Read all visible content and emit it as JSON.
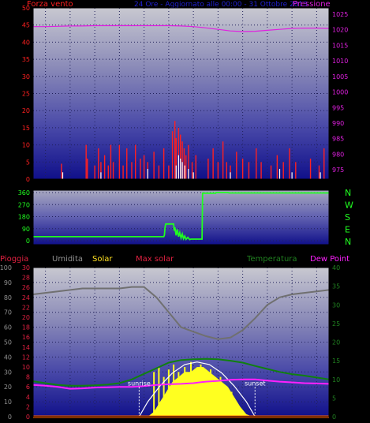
{
  "charts": {
    "top_title": "24 Ore - Aggiornato alle 00:00 - 31 Ottobre 2013",
    "wind_label": "Forza vento",
    "pressure_label": "Pressione",
    "rain_label": "Pioggia",
    "humidity_label": "Umidita",
    "solar_label": "Solar",
    "max_solar_label": "Max solar",
    "temperature_label": "Temperatura",
    "dewpoint_label": "Dew Point",
    "compass_labels": [
      "N",
      "W",
      "S",
      "E",
      "N"
    ],
    "sunrise_label": "sunrise",
    "sunset_label": "sunset",
    "colors": {
      "wind": "#ff2020",
      "gust": "#ffffff",
      "pressure": "#e020e0",
      "direction": "#20ff20",
      "humidity": "#707070",
      "solar": "#ffff20",
      "max_solar": "#ffffff",
      "temperature": "#108010",
      "dewpoint": "#ff20ff",
      "rain": "#ff2020",
      "label_yellow": "#ffe020",
      "label_pink": "#e02040",
      "label_gray": "#909090",
      "label_green": "#208020",
      "label_magenta": "#ff20ff"
    }
  },
  "chart_data": [
    {
      "type": "bar",
      "name": "wind",
      "x_ticks": [
        "03",
        "04",
        "05",
        "06",
        "08",
        "10",
        "12",
        "13",
        "14",
        "16",
        "18",
        "20",
        "22",
        "00"
      ],
      "y_left_ticks": [
        "0",
        "5",
        "10",
        "15",
        "20",
        "25",
        "30",
        "35",
        "40",
        "45",
        "50"
      ],
      "y_right_ticks": [
        "975",
        "980",
        "985",
        "990",
        "995",
        "1000",
        "1005",
        "1010",
        "1015",
        "1020",
        "1025"
      ],
      "ylim_left": [
        0,
        50
      ],
      "ylim_right": [
        972,
        1027
      ],
      "pressure_hourly": [
        1021.0,
        1021.0,
        1021.1,
        1021.2,
        1021.2,
        1021.3,
        1021.3,
        1021.3,
        1021.3,
        1021.3,
        1021.3,
        1021.3,
        1021.2,
        1021.0,
        1020.6,
        1020.1,
        1019.6,
        1019.4,
        1019.5,
        1019.8,
        1020.1,
        1020.4,
        1020.5,
        1020.5,
        1020.4
      ],
      "wind_spikes": [
        [
          2.3,
          4.5
        ],
        [
          4.3,
          10
        ],
        [
          4.4,
          6
        ],
        [
          5.0,
          4
        ],
        [
          5.3,
          9
        ],
        [
          5.5,
          5
        ],
        [
          5.8,
          7
        ],
        [
          6.1,
          4
        ],
        [
          6.3,
          10
        ],
        [
          6.5,
          5
        ],
        [
          7.0,
          10
        ],
        [
          7.3,
          4
        ],
        [
          7.6,
          9
        ],
        [
          8.0,
          5
        ],
        [
          8.3,
          10
        ],
        [
          8.7,
          6
        ],
        [
          9.0,
          7
        ],
        [
          9.3,
          5
        ],
        [
          9.8,
          8
        ],
        [
          10.2,
          4
        ],
        [
          10.6,
          9
        ],
        [
          11.0,
          4
        ],
        [
          11.3,
          14
        ],
        [
          11.5,
          17
        ],
        [
          11.6,
          12
        ],
        [
          11.8,
          15
        ],
        [
          11.95,
          13
        ],
        [
          12.1,
          11
        ],
        [
          12.25,
          9
        ],
        [
          12.4,
          7
        ],
        [
          12.6,
          10
        ],
        [
          12.9,
          5
        ],
        [
          13.2,
          7
        ],
        [
          14.2,
          6
        ],
        [
          14.6,
          9
        ],
        [
          15.0,
          5
        ],
        [
          15.4,
          11
        ],
        [
          15.7,
          5
        ],
        [
          16.0,
          4
        ],
        [
          16.5,
          8
        ],
        [
          17.0,
          6
        ],
        [
          17.5,
          5
        ],
        [
          18.1,
          9
        ],
        [
          18.5,
          5
        ],
        [
          19.3,
          4
        ],
        [
          19.8,
          7
        ],
        [
          20.3,
          5
        ],
        [
          20.8,
          9
        ],
        [
          21.3,
          5
        ],
        [
          22.5,
          6
        ],
        [
          23.2,
          4
        ],
        [
          23.6,
          9
        ]
      ],
      "gust_spikes": [
        [
          2.4,
          2
        ],
        [
          5.5,
          2
        ],
        [
          9.3,
          3
        ],
        [
          11.6,
          4
        ],
        [
          11.8,
          7
        ],
        [
          11.95,
          6
        ],
        [
          12.1,
          5
        ],
        [
          12.3,
          4
        ],
        [
          12.6,
          3
        ],
        [
          13.0,
          2
        ],
        [
          16.0,
          2
        ],
        [
          20.0,
          3
        ],
        [
          21.0,
          2
        ],
        [
          23.3,
          2
        ]
      ]
    },
    {
      "type": "line",
      "name": "wind_direction",
      "y_ticks": [
        "0",
        "90",
        "180",
        "270",
        "360"
      ],
      "ylim": [
        0,
        360
      ],
      "series": [
        [
          0,
          30
        ],
        [
          10.6,
          30
        ],
        [
          10.65,
          42
        ],
        [
          10.7,
          100
        ],
        [
          10.75,
          125
        ],
        [
          11.4,
          125
        ],
        [
          11.45,
          75
        ],
        [
          11.5,
          100
        ],
        [
          11.6,
          40
        ],
        [
          11.7,
          85
        ],
        [
          11.8,
          30
        ],
        [
          11.9,
          60
        ],
        [
          12.0,
          20
        ],
        [
          12.1,
          50
        ],
        [
          12.2,
          15
        ],
        [
          12.3,
          35
        ],
        [
          12.4,
          10
        ],
        [
          12.55,
          25
        ],
        [
          12.7,
          8
        ],
        [
          12.8,
          12
        ],
        [
          13.7,
          12
        ],
        [
          13.75,
          355
        ],
        [
          14.8,
          355
        ],
        [
          14.85,
          360
        ],
        [
          15.8,
          360
        ],
        [
          15.9,
          357
        ],
        [
          24,
          357
        ]
      ]
    },
    {
      "type": "line",
      "name": "temperature_humidity_solar",
      "y_left_ticks": [
        "0",
        "10",
        "20",
        "30",
        "40",
        "50",
        "60",
        "70",
        "80",
        "90",
        "100"
      ],
      "rain_ticks": [
        "0",
        "2",
        "4",
        "6",
        "8",
        "10",
        "12",
        "14",
        "16",
        "18",
        "20",
        "22",
        "24",
        "26",
        "28",
        "30"
      ],
      "y_right_ticks": [
        "0",
        "5",
        "10",
        "15",
        "20",
        "25",
        "30",
        "35",
        "40"
      ],
      "ylim_humidity": [
        0,
        100
      ],
      "ylim_rain": [
        0,
        30
      ],
      "ylim_temp": [
        0,
        40
      ],
      "humidity_hourly": [
        82,
        83,
        84,
        85,
        86,
        86,
        86,
        86,
        87,
        87,
        80,
        70,
        60,
        57,
        54,
        52,
        53,
        58,
        66,
        75,
        80,
        82,
        83,
        84,
        85
      ],
      "temperature_hourly": [
        9.5,
        9.0,
        8.5,
        8.3,
        8.3,
        8.4,
        8.6,
        9.0,
        10.0,
        11.5,
        13.0,
        14.5,
        15.2,
        15.4,
        15.5,
        15.4,
        15.0,
        14.5,
        13.6,
        12.8,
        12.0,
        11.4,
        11.0,
        10.5,
        10.0
      ],
      "dewpoint_hourly": [
        8.5,
        8.3,
        8.0,
        7.5,
        7.6,
        7.8,
        7.9,
        8.0,
        8.0,
        8.2,
        8.5,
        8.7,
        8.8,
        9.0,
        9.4,
        9.6,
        9.9,
        10.0,
        10.0,
        9.7,
        9.4,
        9.2,
        9.0,
        8.9,
        8.8
      ],
      "solar_envelope": [
        [
          4.5,
          0
        ],
        [
          5,
          1
        ],
        [
          5.5,
          3
        ],
        [
          6,
          5
        ],
        [
          6.5,
          7
        ],
        [
          7,
          8
        ],
        [
          7.5,
          9
        ],
        [
          8,
          9
        ],
        [
          8.5,
          10
        ],
        [
          9,
          10
        ],
        [
          9.5,
          9
        ],
        [
          10,
          8
        ],
        [
          10.5,
          7
        ],
        [
          11,
          6
        ],
        [
          11.5,
          4
        ],
        [
          12,
          2
        ],
        [
          12.5,
          0.5
        ],
        [
          13,
          0
        ]
      ],
      "max_solar_envelope": [
        [
          3.8,
          0
        ],
        [
          4.5,
          3
        ],
        [
          5.5,
          6.2
        ],
        [
          6.5,
          8.8
        ],
        [
          7.5,
          10.5
        ],
        [
          8.5,
          11
        ],
        [
          9.5,
          10.5
        ],
        [
          10.5,
          8.8
        ],
        [
          11.5,
          6.2
        ],
        [
          12.5,
          3
        ],
        [
          13.2,
          0
        ]
      ],
      "sunrise_x": 3.8,
      "sunset_x": 13.2
    }
  ]
}
